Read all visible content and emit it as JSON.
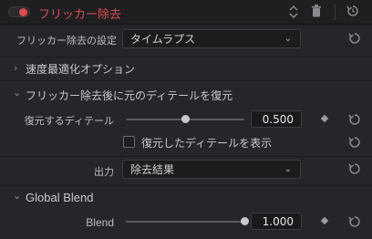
{
  "header": {
    "title": "フリッカー除去"
  },
  "settings": {
    "mode_label": "フリッカー除去の設定",
    "mode_value": "タイムラプス"
  },
  "sections": {
    "speed": "速度最適化オプション",
    "restore": "フリッカー除去後に元のディテールを復元",
    "global_blend": "Global Blend"
  },
  "restore": {
    "detail_label": "復元するディテール",
    "detail_value": "0.500",
    "detail_fraction": 0.5,
    "show_label": "復元したディテールを表示"
  },
  "output": {
    "label": "出力",
    "value": "除去結果"
  },
  "blend": {
    "label": "Blend",
    "value": "1.000",
    "fraction": 1.0
  },
  "colors": {
    "accent_red": "#e24a4a",
    "background": "#26262a"
  },
  "icons": {
    "updown": "chevron-updown-icon",
    "delete": "trash-icon",
    "reset": "reset-icon",
    "keyframe": "keyframe-diamond-icon"
  }
}
